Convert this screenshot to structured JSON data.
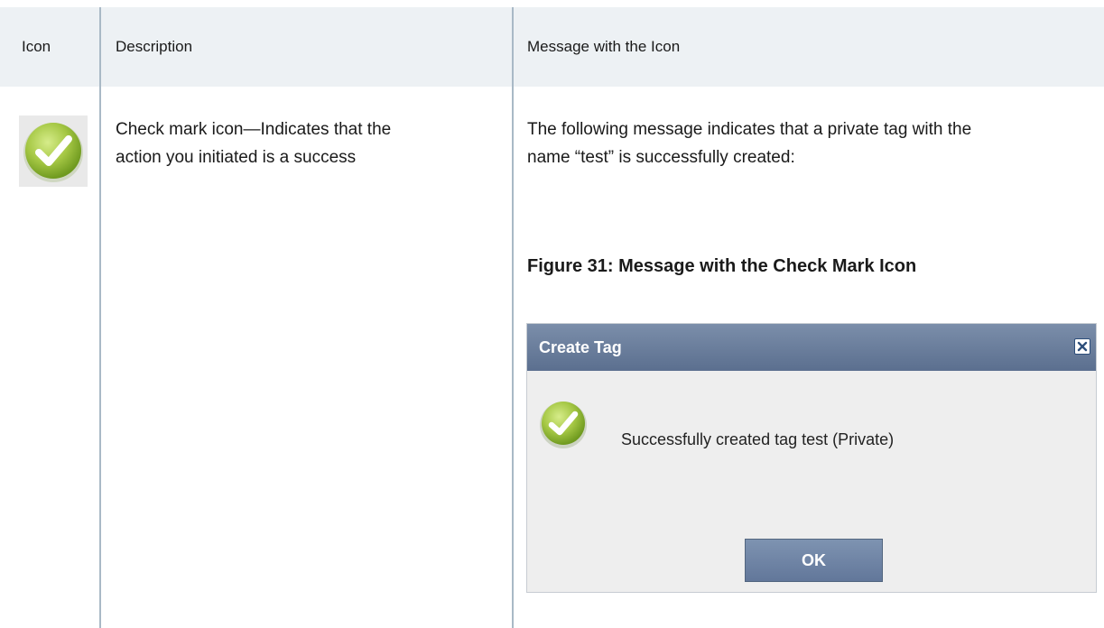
{
  "table": {
    "headers": {
      "icon": "Icon",
      "description": "Description",
      "message": "Message with the Icon"
    },
    "row": {
      "icon_name": "check-mark-icon",
      "description_lines": [
        "Check mark icon—Indicates that the",
        "action you initiated is a success"
      ],
      "message_lines": [
        "The following message indicates that a private tag with the",
        "name “test” is successfully created:"
      ],
      "figure_caption": "Figure 31: Message with the Check Mark Icon"
    }
  },
  "dialog": {
    "title": "Create Tag",
    "message": "Successfully created tag test (Private)",
    "ok_label": "OK",
    "icons": {
      "close": "close-icon",
      "status": "check-mark-icon"
    }
  },
  "colors": {
    "header_bg": "#edf1f4",
    "divider": "#a9b9c6",
    "titlebar": "#6a7e9e",
    "check_green": "#9cc23c"
  }
}
